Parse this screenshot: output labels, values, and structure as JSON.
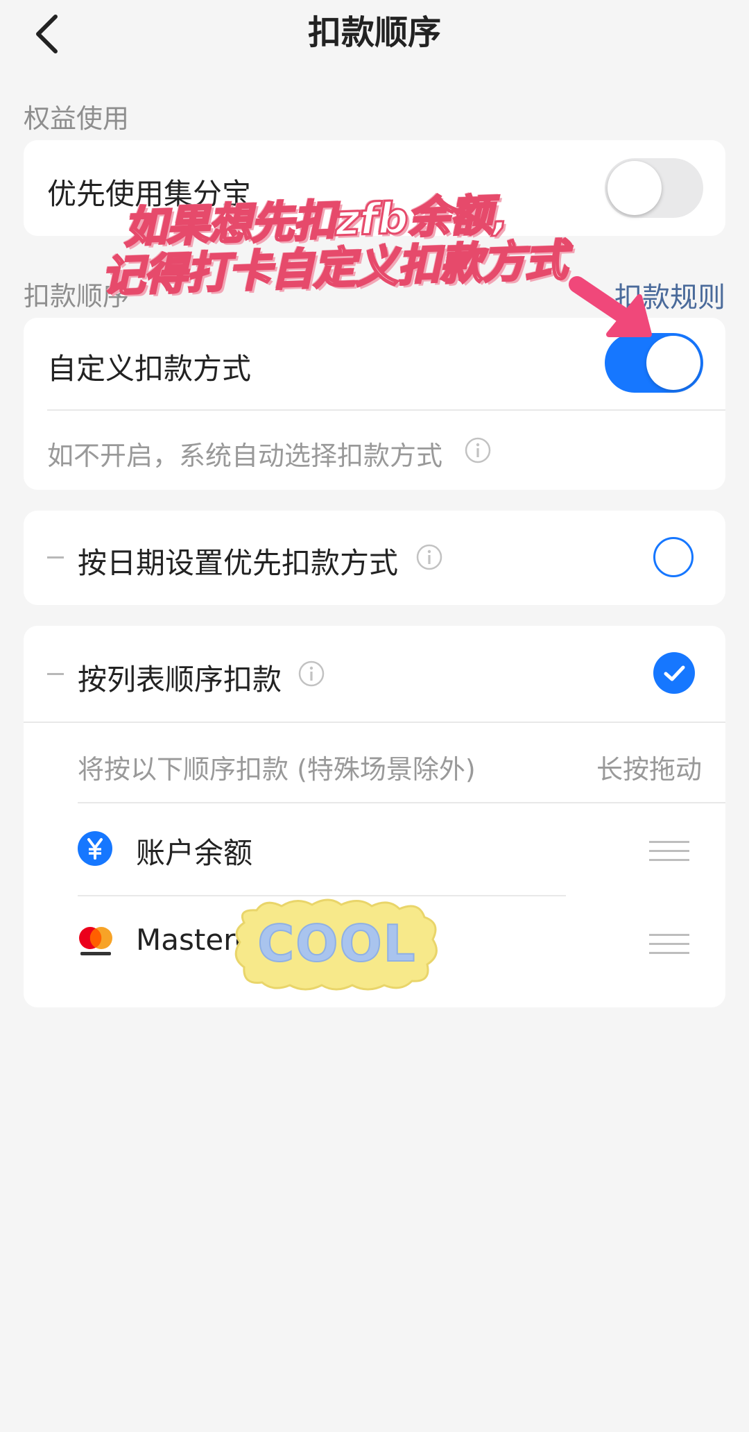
{
  "header": {
    "title": "扣款顺序"
  },
  "benefits": {
    "label": "权益使用",
    "row_label": "优先使用集分宝",
    "toggle_on": false
  },
  "deduction": {
    "label": "扣款顺序",
    "rules_link": "扣款规则",
    "custom_label": "自定义扣款方式",
    "custom_toggle_on": true,
    "custom_hint": "如不开启，系统自动选择扣款方式"
  },
  "by_date": {
    "label": "按日期设置优先扣款方式",
    "selected": false
  },
  "by_list": {
    "label": "按列表顺序扣款",
    "selected": true,
    "subtitle": "将按以下顺序扣款 (特殊场景除外)",
    "drag_hint": "长按拖动",
    "items": [
      {
        "label": "账户余额",
        "icon": "yuan-icon"
      },
      {
        "label": "Mastercard",
        "icon": "mastercard-icon"
      }
    ]
  },
  "overlay": {
    "line1": "如果想先扣zfb余额,",
    "line2": "记得打卡自定义扣款方式",
    "sticker": "COOL"
  },
  "colors": {
    "accent": "#1677ff",
    "arrow": "#f0487a"
  }
}
